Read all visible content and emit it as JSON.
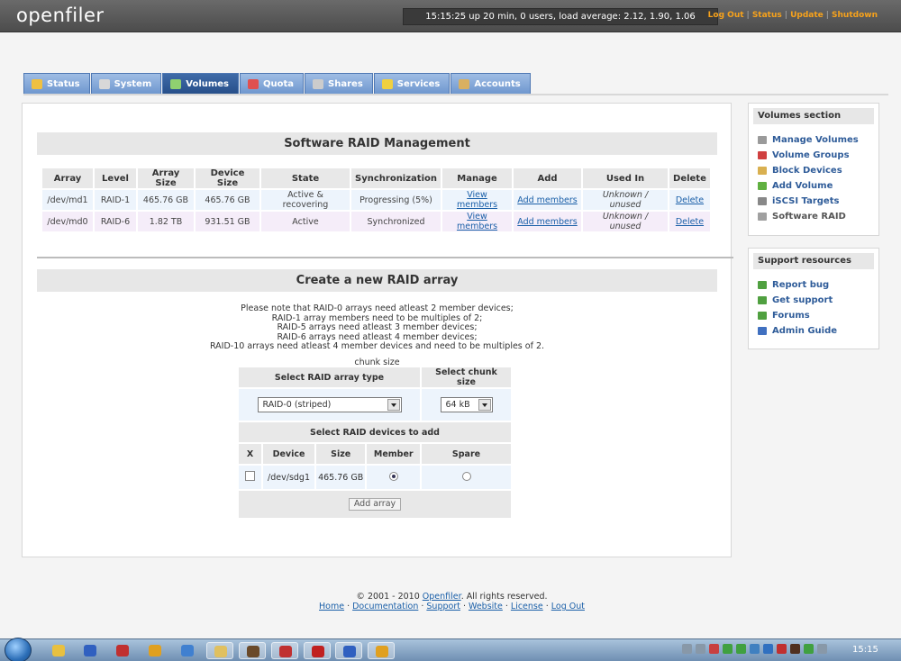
{
  "header": {
    "logo": "openfiler",
    "sysinfo": "15:15:25 up 20 min, 0 users, load average: 2.12, 1.90, 1.06",
    "links": [
      "Log Out",
      "Status",
      "Update",
      "Shutdown"
    ]
  },
  "tabs": [
    {
      "label": "Status",
      "icon": "status-icon",
      "color": "#f0c040"
    },
    {
      "label": "System",
      "icon": "system-icon",
      "color": "#d8d8d8"
    },
    {
      "label": "Volumes",
      "icon": "volumes-icon",
      "color": "#8fd070",
      "active": true
    },
    {
      "label": "Quota",
      "icon": "quota-icon",
      "color": "#e05050"
    },
    {
      "label": "Shares",
      "icon": "shares-icon",
      "color": "#cccccc"
    },
    {
      "label": "Services",
      "icon": "services-icon",
      "color": "#f0d040"
    },
    {
      "label": "Accounts",
      "icon": "accounts-icon",
      "color": "#d9b060"
    }
  ],
  "raid": {
    "title": "Software RAID Management",
    "columns": [
      "Array",
      "Level",
      "Array Size",
      "Device Size",
      "State",
      "Synchronization",
      "Manage",
      "Add",
      "Used In",
      "Delete"
    ],
    "rows": [
      {
        "array": "/dev/md1",
        "level": "RAID-1",
        "array_size": "465.76 GB",
        "device_size": "465.76 GB",
        "state": "Active & recovering",
        "sync": "Progressing (5%)",
        "manage": "View members",
        "add": "Add members",
        "used_in": "Unknown / unused",
        "delete": "Delete"
      },
      {
        "array": "/dev/md0",
        "level": "RAID-6",
        "array_size": "1.82 TB",
        "device_size": "931.51 GB",
        "state": "Active",
        "sync": "Synchronized",
        "manage": "View members",
        "add": "Add members",
        "used_in": "Unknown / unused",
        "delete": "Delete"
      }
    ]
  },
  "create": {
    "title": "Create a new RAID array",
    "notes": [
      "Please note that RAID-0 arrays need atleast 2 member devices;",
      "RAID-1 array members need to be multiples of 2;",
      "RAID-5 arrays need atleast 3 member devices;",
      "RAID-6 arrays need atleast 4 member devices;",
      "RAID-10 arrays need atleast 4 member devices and need to be multiples of 2."
    ],
    "chunk_caption": "chunk size",
    "type_header": "Select RAID array type",
    "chunk_header": "Select chunk size",
    "type_value": "RAID-0 (striped)",
    "chunk_value": "64 kB",
    "devices_header": "Select RAID devices to add",
    "device_columns": [
      "X",
      "Device",
      "Size",
      "Member",
      "Spare"
    ],
    "devices": [
      {
        "device": "/dev/sdg1",
        "size": "465.76 GB",
        "member": true,
        "spare": false,
        "checked": false
      }
    ],
    "add_button": "Add array"
  },
  "sidebar": {
    "volumes": {
      "title": "Volumes section",
      "items": [
        {
          "label": "Manage Volumes",
          "color": "#9a9a9a"
        },
        {
          "label": "Volume Groups",
          "color": "#d04040"
        },
        {
          "label": "Block Devices",
          "color": "#d9b050"
        },
        {
          "label": "Add Volume",
          "color": "#60b040"
        },
        {
          "label": "iSCSI Targets",
          "color": "#888888"
        },
        {
          "label": "Software RAID",
          "color": "#a0a0a0",
          "current": true
        }
      ]
    },
    "support": {
      "title": "Support resources",
      "items": [
        {
          "label": "Report bug",
          "color": "#50a040"
        },
        {
          "label": "Get support",
          "color": "#50a040"
        },
        {
          "label": "Forums",
          "color": "#50a040"
        },
        {
          "label": "Admin Guide",
          "color": "#4070c0"
        }
      ]
    }
  },
  "footer": {
    "copyright_prefix": "© 2001 - 2010 ",
    "copyright_link": "Openfiler",
    "copyright_suffix": ". All rights reserved.",
    "links": [
      "Home",
      "Documentation",
      "Support",
      "Website",
      "License",
      "Log Out"
    ]
  },
  "taskbar": {
    "apps": [
      {
        "name": "folder-app-icon",
        "color": "#e8c040"
      },
      {
        "name": "tool-app-icon",
        "color": "#3060c0"
      },
      {
        "name": "mail-app-icon",
        "color": "#c03030"
      },
      {
        "name": "chrome-app-icon",
        "color": "#e0a020"
      },
      {
        "name": "network-app-icon",
        "color": "#4080d0"
      },
      {
        "name": "explorer-app-icon",
        "color": "#e0c060",
        "active": true
      },
      {
        "name": "user-app-icon",
        "color": "#6a4a2a",
        "active": true
      },
      {
        "name": "mail2-app-icon",
        "color": "#c03030",
        "active": true
      },
      {
        "name": "pdf-app-icon",
        "color": "#c02020",
        "active": true
      },
      {
        "name": "tool2-app-icon",
        "color": "#3060c0",
        "active": true
      },
      {
        "name": "chrome2-app-icon",
        "color": "#e0a020",
        "active": true
      }
    ],
    "tray": [
      "#8898a8",
      "#8898a8",
      "#c84040",
      "#40a040",
      "#40a040",
      "#4080c0",
      "#3070c0",
      "#c03030",
      "#503020",
      "#40a040",
      "#8898a8"
    ],
    "clock": "15:15"
  }
}
